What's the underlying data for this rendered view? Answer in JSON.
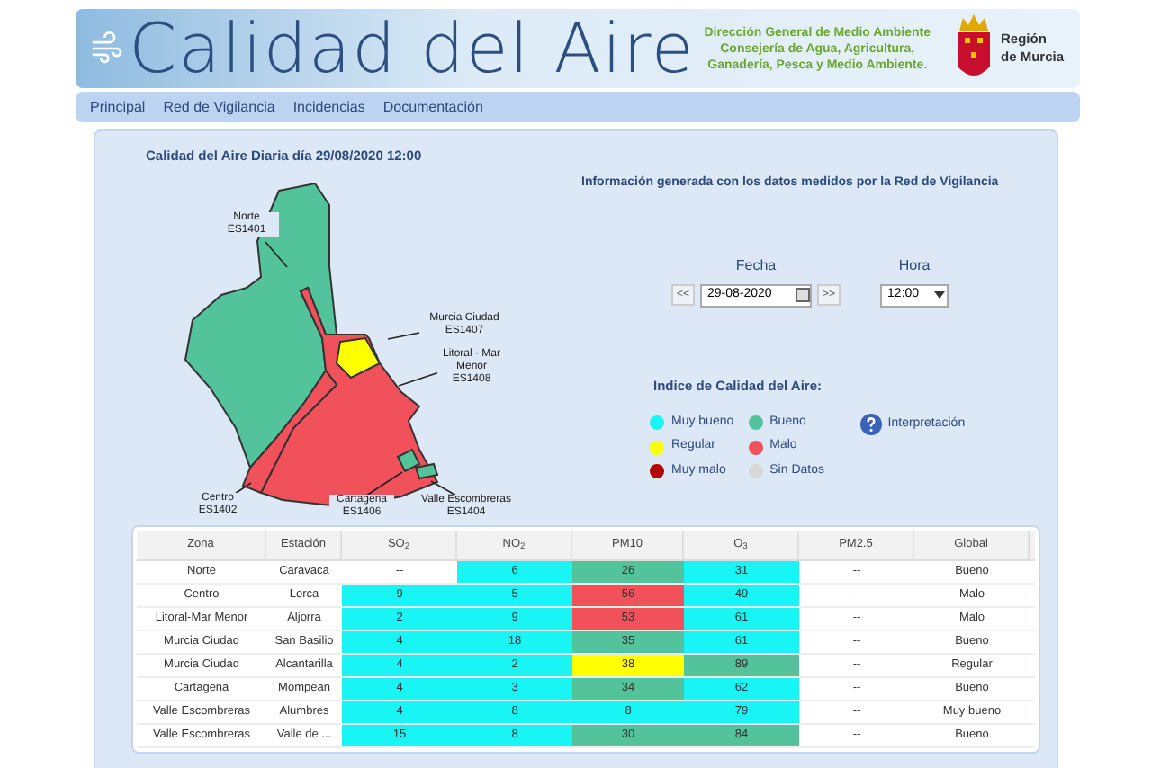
{
  "header": {
    "title": "Calidad del Aire",
    "agency": [
      "Dirección General de Medio Ambiente",
      "Consejería de Agua, Agricultura, Ganadería, Pesca y Medio Ambiente."
    ],
    "region": "Región de Murcia"
  },
  "nav": [
    "Principal",
    "Red de Vigilancia",
    "Incidencias",
    "Documentación"
  ],
  "heading": "Calidad del Aire Diaria día 29/08/2020 12:00",
  "info": "Información generada con los datos medidos por la Red de Vigilancia",
  "map": {
    "zones": [
      {
        "name": "Norte",
        "code": "ES1401",
        "color": "#52c39a"
      },
      {
        "name": "Centro",
        "code": "ES1402",
        "color": "#f0515a"
      },
      {
        "name": "Murcia Ciudad",
        "code": "ES1407",
        "color": "#ffff00"
      },
      {
        "name": "Litoral - Mar Menor",
        "code": "ES1408",
        "color": "#f0515a"
      },
      {
        "name": "Cartagena",
        "code": "ES1406",
        "color": "#52c39a"
      },
      {
        "name": "Valle Escombreras",
        "code": "ES1404",
        "color": "#52c39a"
      }
    ]
  },
  "date": {
    "label": "Fecha",
    "prev": "<<",
    "value": "29-08-2020",
    "next": ">>"
  },
  "hour": {
    "label": "Hora",
    "value": "12:00"
  },
  "legend": {
    "title": "Indice de Calidad del Aire:",
    "items": [
      {
        "label": "Muy bueno",
        "color": "#19f5f5"
      },
      {
        "label": "Bueno",
        "color": "#52c39a"
      },
      {
        "label": "Regular",
        "color": "#ffff00"
      },
      {
        "label": "Malo",
        "color": "#f0515a"
      },
      {
        "label": "Muy malo",
        "color": "#b00000"
      },
      {
        "label": "Sin Datos",
        "color": "#d8d8d8"
      }
    ],
    "help": "Interpretación"
  },
  "table": {
    "columns": [
      "Zona",
      "Estación",
      "SO$_{2}$",
      "NO$_{2}$",
      "PM10",
      "O$_{3}$",
      "PM2.5",
      "Global"
    ],
    "rows": [
      {
        "zone": "Norte",
        "station": "Caravaca",
        "values": [
          {
            "text": "--"
          },
          {
            "text": "6",
            "color": "#19f5f5"
          },
          {
            "text": "26",
            "color": "#52c39a"
          },
          {
            "text": "31",
            "color": "#19f5f5"
          },
          {
            "text": "--"
          }
        ],
        "global": "Bueno"
      },
      {
        "zone": "Centro",
        "station": "Lorca",
        "values": [
          {
            "text": "9",
            "color": "#19f5f5"
          },
          {
            "text": "5",
            "color": "#19f5f5"
          },
          {
            "text": "56",
            "color": "#f0515a"
          },
          {
            "text": "49",
            "color": "#19f5f5"
          },
          {
            "text": "--"
          }
        ],
        "global": "Malo"
      },
      {
        "zone": "Litoral-Mar Menor",
        "station": "Aljorra",
        "values": [
          {
            "text": "2",
            "color": "#19f5f5"
          },
          {
            "text": "9",
            "color": "#19f5f5"
          },
          {
            "text": "53",
            "color": "#f0515a"
          },
          {
            "text": "61",
            "color": "#19f5f5"
          },
          {
            "text": "--"
          }
        ],
        "global": "Malo"
      },
      {
        "zone": "Murcia Ciudad",
        "station": "San Basilio",
        "values": [
          {
            "text": "4",
            "color": "#19f5f5"
          },
          {
            "text": "18",
            "color": "#19f5f5"
          },
          {
            "text": "35",
            "color": "#52c39a"
          },
          {
            "text": "61",
            "color": "#19f5f5"
          },
          {
            "text": "--"
          }
        ],
        "global": "Bueno"
      },
      {
        "zone": "Murcia Ciudad",
        "station": "Alcantarilla",
        "values": [
          {
            "text": "4",
            "color": "#19f5f5"
          },
          {
            "text": "2",
            "color": "#19f5f5"
          },
          {
            "text": "38",
            "color": "#ffff00"
          },
          {
            "text": "89",
            "color": "#52c39a"
          },
          {
            "text": "--"
          }
        ],
        "global": "Regular"
      },
      {
        "zone": "Cartagena",
        "station": "Mompean",
        "values": [
          {
            "text": "4",
            "color": "#19f5f5"
          },
          {
            "text": "3",
            "color": "#19f5f5"
          },
          {
            "text": "34",
            "color": "#52c39a"
          },
          {
            "text": "62",
            "color": "#19f5f5"
          },
          {
            "text": "--"
          }
        ],
        "global": "Bueno"
      },
      {
        "zone": "Valle Escombreras",
        "station": "Alumbres",
        "values": [
          {
            "text": "4",
            "color": "#19f5f5"
          },
          {
            "text": "8",
            "color": "#19f5f5"
          },
          {
            "text": "8",
            "color": "#19f5f5"
          },
          {
            "text": "79",
            "color": "#19f5f5"
          },
          {
            "text": "--"
          }
        ],
        "global": "Muy bueno"
      },
      {
        "zone": "Valle Escombreras",
        "station": "Valle de ...",
        "values": [
          {
            "text": "15",
            "color": "#19f5f5"
          },
          {
            "text": "8",
            "color": "#19f5f5"
          },
          {
            "text": "30",
            "color": "#52c39a"
          },
          {
            "text": "84",
            "color": "#52c39a"
          },
          {
            "text": "--"
          }
        ],
        "global": "Bueno"
      }
    ]
  }
}
